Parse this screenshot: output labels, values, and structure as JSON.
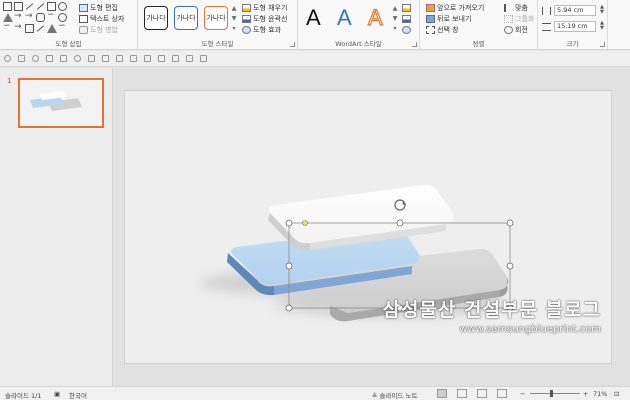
{
  "ribbon": {
    "shapes_group": {
      "label": "도형 삽입",
      "edit_shape": "도형 편집",
      "text_box": "텍스트 상자",
      "merge_shapes": "도형 병합"
    },
    "styles_group": {
      "label": "도형 스타일",
      "presets": [
        "가나다",
        "가나다",
        "가나다"
      ],
      "fill": "도형 채우기",
      "outline": "도형 윤곽선",
      "effects": "도형 효과"
    },
    "wordart_group": {
      "label": "WordArt 스타일",
      "letters": [
        "A",
        "A",
        "A"
      ]
    },
    "arrange_group": {
      "label": "정렬",
      "bring_forward": "앞으로 가져오기",
      "send_backward": "뒤로 보내기",
      "selection_pane": "선택 창",
      "align": "맞춤",
      "group": "그룹화",
      "rotate": "회전"
    },
    "size_group": {
      "label": "크기",
      "height": "5.94 cm",
      "width": "15.19 cm"
    }
  },
  "thumbnail": {
    "number": "1"
  },
  "watermark": {
    "title": "삼성물산 건설부문 블로그",
    "url": "www.samsungblueprint.com"
  },
  "status": {
    "slide_info": "슬라이드 1/1",
    "language": "한국어",
    "notes": "슬라이드 노트",
    "zoom": "71%"
  },
  "colors": {
    "accent_orange": "#e0733b",
    "shape_blue": "#bcd8f1",
    "shape_white": "#ffffff",
    "shape_gray": "#dadada"
  }
}
